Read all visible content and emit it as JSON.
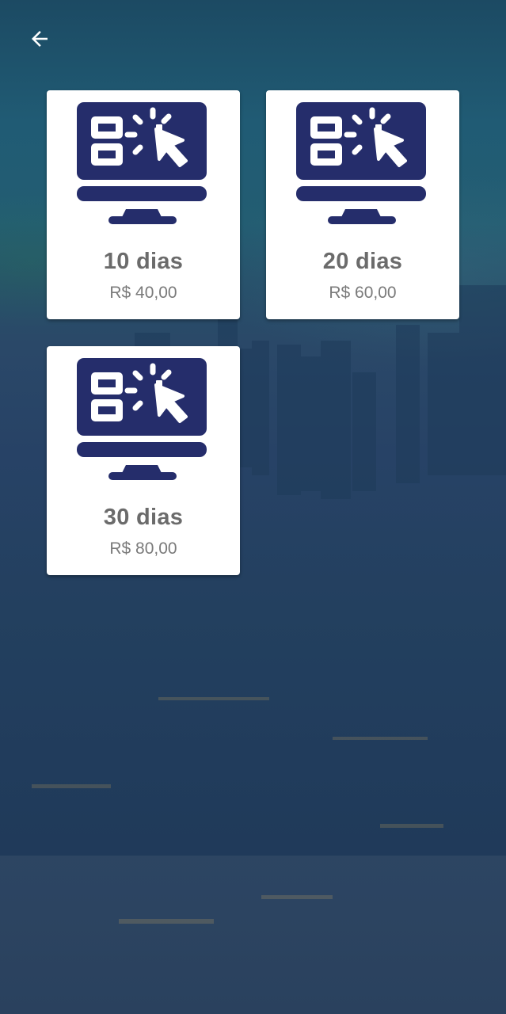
{
  "header": {
    "back_icon": "arrow-left-icon"
  },
  "colors": {
    "icon_primary": "#252d6b",
    "card_background": "#ffffff",
    "days_text": "#6b6b6b",
    "price_text": "#7a7a7a"
  },
  "plans": [
    {
      "days": "10 dias",
      "price": "R$ 40,00",
      "icon": "monitor-qr-click-icon"
    },
    {
      "days": "20 dias",
      "price": "R$ 60,00",
      "icon": "monitor-qr-click-icon"
    },
    {
      "days": "30 dias",
      "price": "R$ 80,00",
      "icon": "monitor-qr-click-icon"
    }
  ]
}
